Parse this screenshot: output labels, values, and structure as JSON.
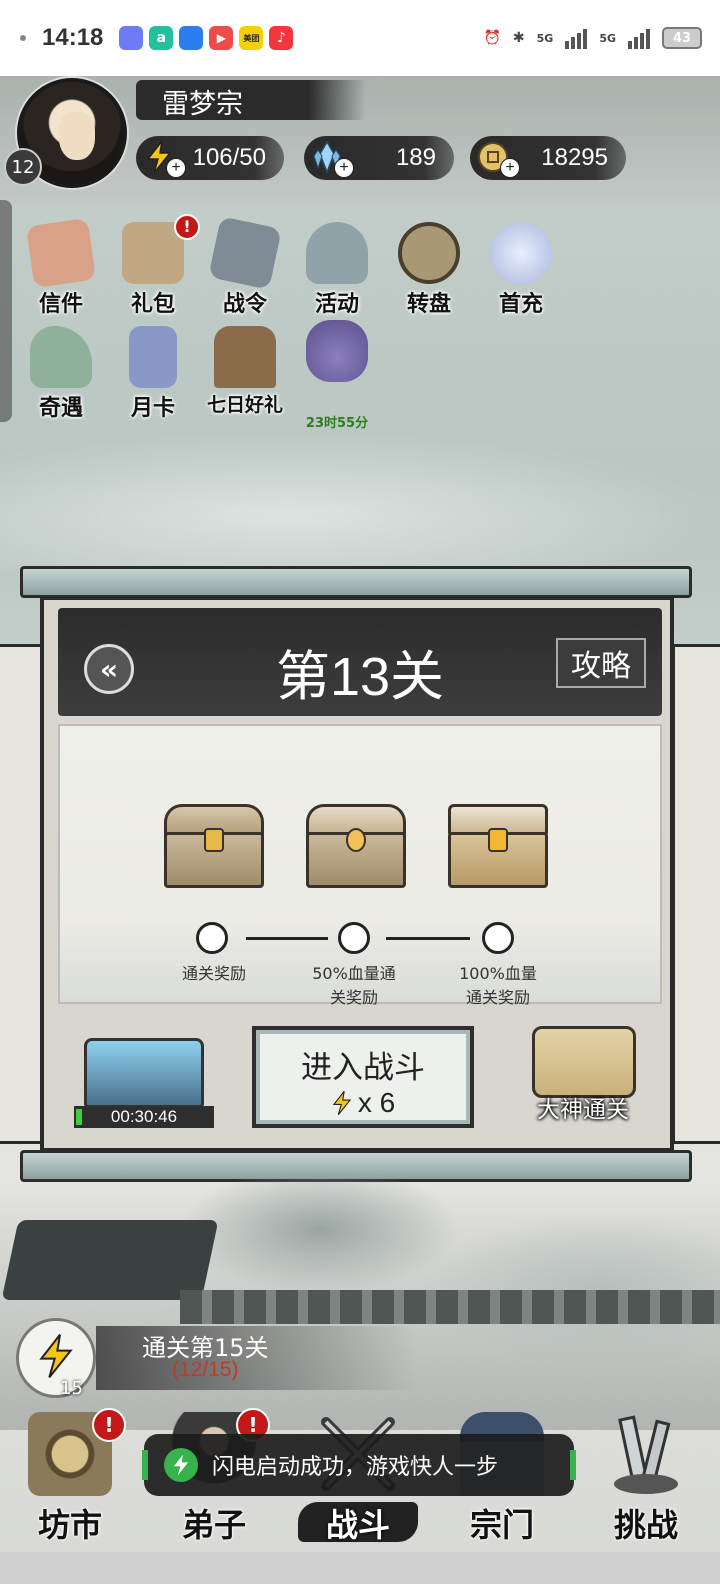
{
  "status_bar": {
    "time": "14:18",
    "apps": [
      {
        "icon": "photos-icon",
        "color": "#6c7cf5",
        "text": ""
      },
      {
        "icon": "browser-icon",
        "color": "#1fc29d",
        "text": "a"
      },
      {
        "icon": "store-icon",
        "color": "#2a7ef0",
        "text": ""
      },
      {
        "icon": "video-icon",
        "color": "#f04a4a",
        "text": "▶"
      },
      {
        "icon": "meituan-icon",
        "color": "#f5d000",
        "text": "美团"
      },
      {
        "icon": "music-icon",
        "color": "#f2353e",
        "text": "♪"
      }
    ],
    "network_1": "5G",
    "network_2": "5G",
    "battery": "43"
  },
  "player": {
    "name": "雷梦宗",
    "level": "12",
    "energy": "106/50",
    "crystals": "189",
    "coins": "18295"
  },
  "activities": [
    {
      "label": "信件",
      "icon": "letter-icon",
      "color": "#d9a187",
      "badge": ""
    },
    {
      "label": "礼包",
      "icon": "gift-pack-icon",
      "color": "#bfa883",
      "badge": "!"
    },
    {
      "label": "战令",
      "icon": "battle-pass-icon",
      "color": "#7f8c96",
      "badge": ""
    },
    {
      "label": "活动",
      "icon": "event-icon",
      "color": "#8fa3a8",
      "badge": ""
    },
    {
      "label": "转盘",
      "icon": "wheel-icon",
      "color": "#a89874",
      "badge": ""
    },
    {
      "label": "首充",
      "icon": "first-recharge-icon",
      "color": "#b8c4e0",
      "badge": ""
    },
    {
      "label": "奇遇",
      "icon": "adventure-icon",
      "color": "#8fb09a",
      "badge": ""
    },
    {
      "label": "月卡",
      "icon": "monthly-card-icon",
      "color": "#8a98c8",
      "badge": ""
    },
    {
      "label": "七日好礼",
      "icon": "seven-day-gift-icon",
      "color": "#8a6b4a",
      "badge": ""
    },
    {
      "label": "",
      "icon": "treasure-bag-icon",
      "color": "#8b7fc0",
      "badge": "",
      "timer": "23时55分"
    }
  ],
  "level_panel": {
    "title": "第13关",
    "guide_label": "攻略",
    "rewards": [
      {
        "label_1": "通关奖励",
        "label_2": ""
      },
      {
        "label_1": "50%血量通",
        "label_2": "关奖励"
      },
      {
        "label_1": "100%血量",
        "label_2": "通关奖励"
      }
    ],
    "loot_timer": "00:30:46",
    "battle_label": "进入战斗",
    "battle_cost": "x 6",
    "master_clear_label": "大神通关"
  },
  "progress": {
    "title": "通关第15关",
    "sub": "(12/15)",
    "count": "15"
  },
  "nav": [
    {
      "label": "坊市",
      "icon": "market-icon",
      "badge": "!"
    },
    {
      "label": "弟子",
      "icon": "disciple-icon",
      "badge": "!"
    },
    {
      "label": "战斗",
      "icon": "battle-icon",
      "badge": "",
      "active": true
    },
    {
      "label": "宗门",
      "icon": "sect-icon",
      "badge": ""
    },
    {
      "label": "挑战",
      "icon": "challenge-icon",
      "badge": ""
    }
  ],
  "toast": {
    "text": "闪电启动成功，游戏快人一步"
  }
}
